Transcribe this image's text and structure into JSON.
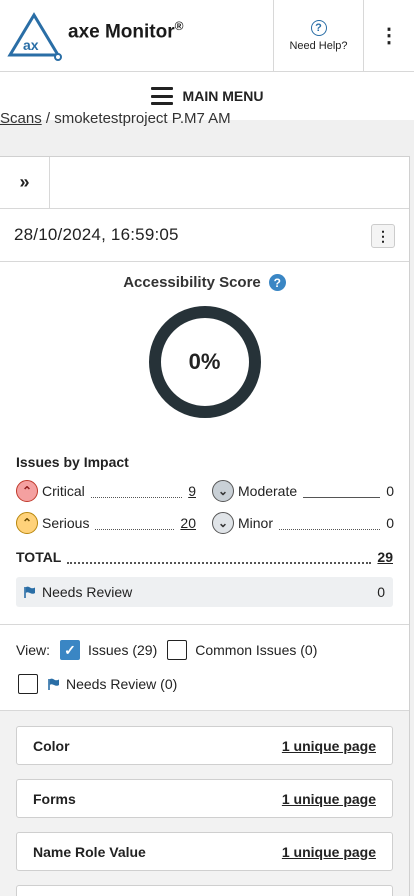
{
  "header": {
    "brand_name": "axe Monitor",
    "registered": "®",
    "logo_text": "ax",
    "help_label": "Need Help?",
    "help_icon": "question-circle-icon",
    "menu_icon": "kebab-vertical-icon"
  },
  "menubar": {
    "label": "MAIN MENU",
    "icon": "hamburger-icon"
  },
  "breadcrumb": {
    "link": "Scans",
    "separator": " / ",
    "current": "smoketestproject P.M7 AM"
  },
  "toolbar": {
    "expand_icon": "double-chevron-right-icon"
  },
  "scan": {
    "date": "28/10/2024, 16:59:05"
  },
  "score": {
    "title": "Accessibility Score",
    "help": "?",
    "value": "0%",
    "percent": 0,
    "ring_color": "#263238"
  },
  "impact": {
    "title": "Issues by Impact",
    "critical": {
      "label": "Critical",
      "count": "9",
      "color": "#f4a0a0"
    },
    "serious": {
      "label": "Serious",
      "count": "20",
      "color": "#ffd27a"
    },
    "moderate": {
      "label": "Moderate",
      "count": "0",
      "color": "#c9d0d6"
    },
    "minor": {
      "label": "Minor",
      "count": "0",
      "color": "#e0e4e8"
    },
    "total_label": "TOTAL",
    "total_count": "29",
    "review_label": "Needs Review",
    "review_count": "0"
  },
  "view": {
    "label": "View:",
    "issues": "Issues (29)",
    "common": "Common Issues (0)",
    "needs_review": "Needs Review (0)"
  },
  "groups": [
    {
      "name": "Color",
      "link": "1 unique page"
    },
    {
      "name": "Forms",
      "link": "1 unique page"
    },
    {
      "name": "Name Role Value",
      "link": "1 unique page"
    }
  ],
  "colors": {
    "accent": "#3a86c4",
    "text": "#222222"
  }
}
